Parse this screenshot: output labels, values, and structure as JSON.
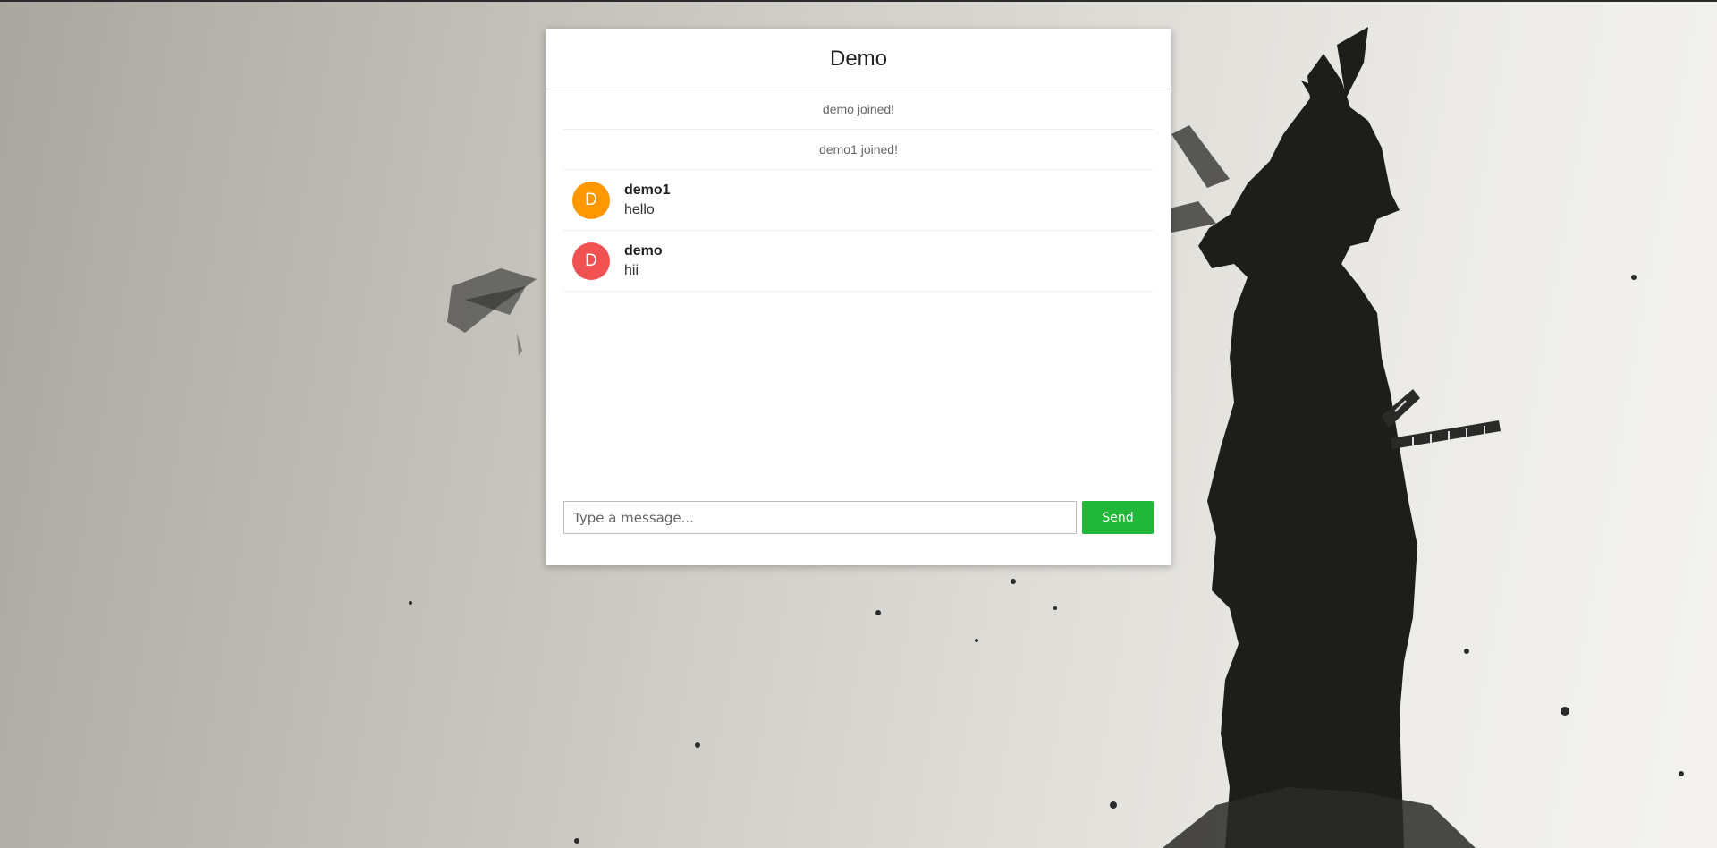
{
  "app": {
    "title": "Demo"
  },
  "messages": {
    "system": [
      {
        "text": "demo joined!"
      },
      {
        "text": "demo1 joined!"
      }
    ],
    "chat": [
      {
        "avatar_letter": "D",
        "avatar_color": "#ff9800",
        "user": "demo1",
        "text": "hello"
      },
      {
        "avatar_letter": "D",
        "avatar_color": "#f05252",
        "user": "demo",
        "text": "hii"
      }
    ]
  },
  "composer": {
    "placeholder": "Type a message...",
    "value": "",
    "send_label": "Send"
  },
  "colors": {
    "send_button": "#21b83a",
    "panel_background": "#ffffff"
  },
  "background": {
    "icon": "samurai-wallpaper-icon"
  }
}
